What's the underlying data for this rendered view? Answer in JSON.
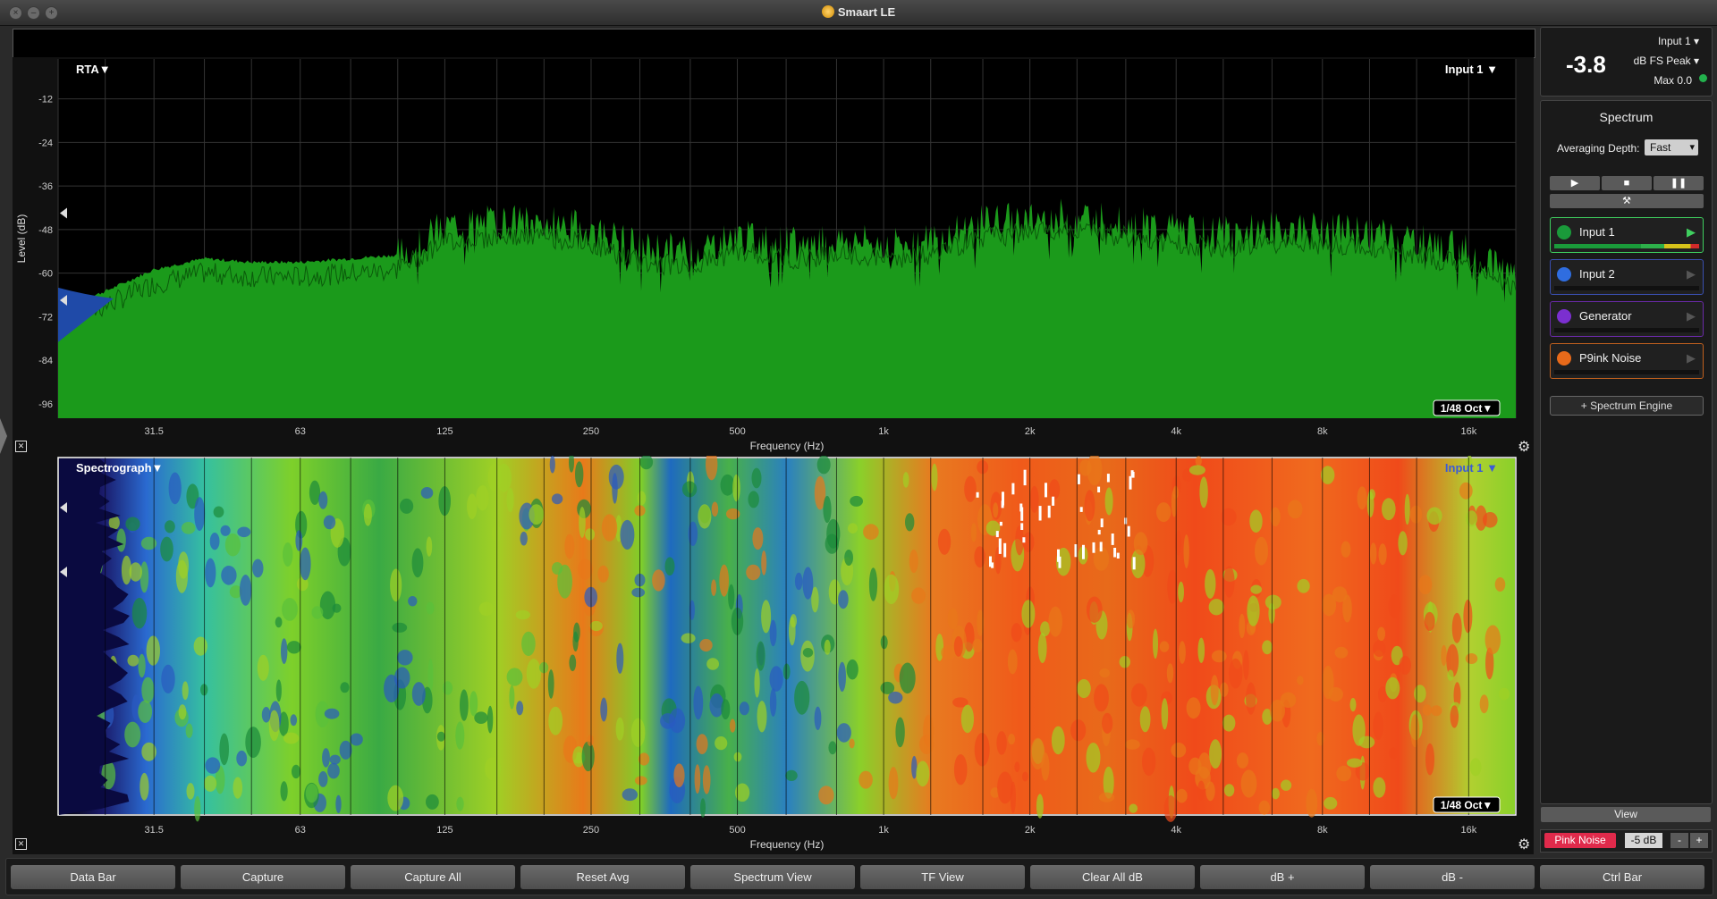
{
  "window": {
    "title": "Smaart LE"
  },
  "rta": {
    "label": "RTA▼",
    "input_label": "Input 1 ▼",
    "resolution": "1/48 Oct▼",
    "ylabel": "Level (dB)",
    "xlabel": "Frequency (Hz)"
  },
  "spectrograph": {
    "label": "Spectrograph▼",
    "input_label": "Input 1 ▼",
    "resolution": "1/48 Oct▼",
    "xlabel": "Frequency (Hz)"
  },
  "chart_data": [
    {
      "type": "area",
      "title": "RTA",
      "xlabel": "Frequency (Hz)",
      "ylabel": "Level (dB)",
      "x_scale": "log",
      "x": [
        20,
        25,
        31.5,
        40,
        50,
        63,
        80,
        100,
        125,
        160,
        200,
        250,
        315,
        400,
        500,
        630,
        800,
        1000,
        1250,
        1600,
        2000,
        2500,
        3150,
        4000,
        5000,
        6300,
        8000,
        10000,
        12500,
        16000,
        20000
      ],
      "y": [
        -70,
        -65,
        -59,
        -56,
        -57,
        -57,
        -56,
        -55,
        -47,
        -46,
        -46,
        -48,
        -53,
        -54,
        -50,
        -52,
        -51,
        -52,
        -51,
        -46,
        -45,
        -44,
        -46,
        -48,
        -49,
        -48,
        -48,
        -49,
        -51,
        -54,
        -60
      ],
      "xticks": [
        "31.5",
        "63",
        "125",
        "250",
        "500",
        "1k",
        "2k",
        "4k",
        "8k",
        "16k"
      ],
      "yticks": [
        "-12",
        "-24",
        "-36",
        "-48",
        "-60",
        "-72",
        "-84",
        "-96"
      ],
      "ylim": [
        -100,
        -1
      ],
      "xlim": [
        20,
        20000
      ],
      "grid": true
    },
    {
      "type": "heatmap",
      "title": "Spectrograph",
      "xlabel": "Frequency (Hz)",
      "x_scale": "log",
      "xticks": [
        "31.5",
        "63",
        "125",
        "250",
        "500",
        "1k",
        "2k",
        "4k",
        "8k",
        "16k"
      ],
      "xlim": [
        20,
        20000
      ],
      "grid": true
    }
  ],
  "meter": {
    "value": "-3.8",
    "input": "Input 1",
    "unit": "dB FS Peak",
    "max": "Max 0.0"
  },
  "spectrum_panel": {
    "title": "Spectrum",
    "averaging_label": "Averaging Depth:",
    "averaging_value": "Fast",
    "channels": [
      {
        "label": "Input 1",
        "color": "#1a9a3a",
        "border": "#3fcf5f"
      },
      {
        "label": "Input 2",
        "color": "#2f6de0",
        "border": "#3a4fb0"
      },
      {
        "label": "Generator",
        "color": "#7b2fd0",
        "border": "#6a2aa8"
      },
      {
        "label": "P9ink Noise",
        "color": "#e86a1a",
        "border": "#c0601e"
      }
    ],
    "add_engine": "+ Spectrum Engine"
  },
  "view_label": "View",
  "pink_noise": {
    "button": "Pink Noise",
    "level": "-5 dB",
    "minus": "-",
    "plus": "+"
  },
  "command_bar": [
    "Data Bar",
    "Capture",
    "Capture All",
    "Reset Avg",
    "Spectrum View",
    "TF View",
    "Clear All dB",
    "dB +",
    "dB -",
    "Ctrl Bar"
  ]
}
